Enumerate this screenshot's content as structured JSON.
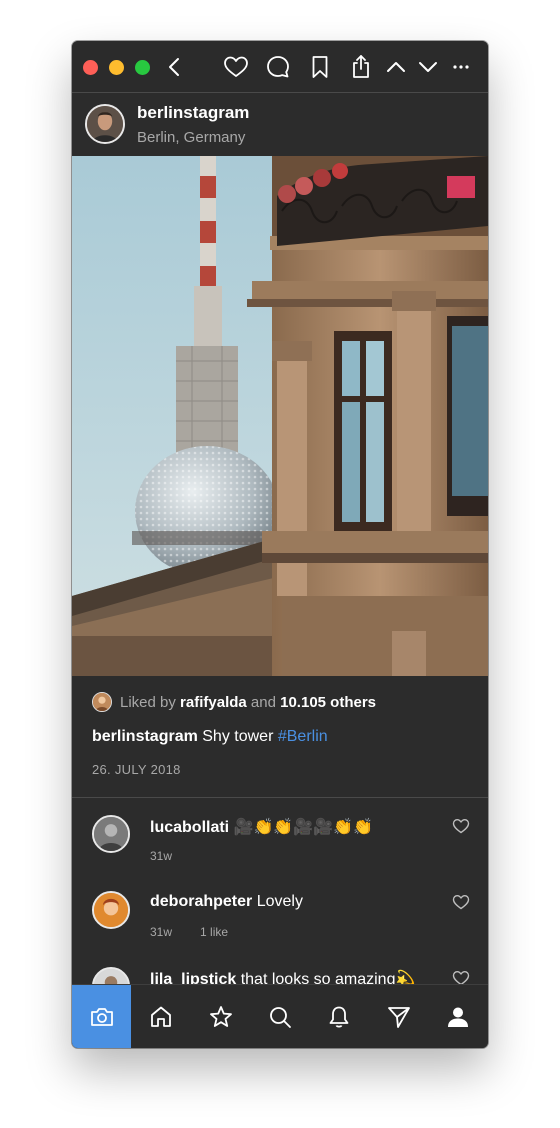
{
  "toolbar": {
    "icons": [
      "back-chevron-icon",
      "heart-icon",
      "comment-icon",
      "bookmark-icon",
      "share-icon",
      "chevron-up-icon",
      "chevron-down-icon",
      "more-icon"
    ]
  },
  "post": {
    "username": "berlinstagram",
    "location": "Berlin, Germany",
    "likes": {
      "prefix": "Liked by ",
      "first_liker": "rafifyalda",
      "middle": " and ",
      "others": "10.105 others"
    },
    "caption": {
      "username": "berlinstagram",
      "text": " Shy tower ",
      "hashtag": "#Berlin"
    },
    "date": "26. JULY 2018"
  },
  "comments": [
    {
      "username": "lucabollati",
      "text": " 🎥👏👏🎥🎥👏👏",
      "age": "31w",
      "likes": ""
    },
    {
      "username": "deborahpeter",
      "text": " Lovely",
      "age": "31w",
      "likes": "1 like"
    },
    {
      "username": "lila_lipstick",
      "text": " that looks so amazing💫",
      "age": "",
      "likes": ""
    }
  ],
  "tabbar": {
    "tabs": [
      "camera-icon",
      "home-icon",
      "star-icon",
      "search-icon",
      "bell-icon",
      "send-icon",
      "profile-icon"
    ],
    "active_tab": "camera-icon"
  },
  "colors": {
    "background": "#2c2c2c",
    "accent": "#4a90e2",
    "muted_text": "#a8a8a8"
  }
}
